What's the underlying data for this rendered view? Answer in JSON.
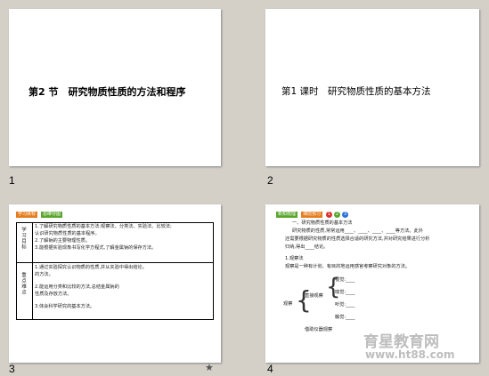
{
  "slides": [
    {
      "number": "1",
      "title": "第2 节　研究物质性质的方法和程序"
    },
    {
      "number": "2",
      "title": "第1 课时　研究物质性质的基本方法"
    },
    {
      "number": "3",
      "tags": [
        "学习目标",
        "思维导图"
      ],
      "section_labels": [
        "学习目标",
        "重点难点"
      ],
      "goals": [
        "1.了解研究物质性质的基本方法:观察法、分类法、实验法、比较法;",
        "认识研究物质性质的基本程序。",
        "2.了解钠的主要物理性质。",
        "3.能根据实验现象书写化学方程式,了解金属钠的保存方法。"
      ],
      "keypoints": [
        "1.通过实验探究认识物质的性质,并从实验中得出结论。",
        "的方法。",
        "2.能运用分类和比较的方法,总结金属钠的",
        "性质及存放方法。",
        "3.体会科学研究的基本方法。"
      ],
      "star": "★"
    },
    {
      "number": "4",
      "tags": [
        "新知梳理",
        "课前预习"
      ],
      "dots": [
        "1",
        "2",
        "3"
      ],
      "lines": [
        "一、研究物质性质的基本方法",
        "研究物质的性质,常常运用____、____、____、____等方法。此外",
        "还需要根据研究物质的性质选择合适的研究方法,并对研究结果进行分析",
        "归纳,得出____结论。",
        "1.观察法",
        "观察是一种有计划、有目的地运用感官考察研究对象的方法。"
      ],
      "diagram_labels": {
        "root": "观察",
        "direct": "直接观察",
        "indirect": "借助仪器观察",
        "items": [
          "视觉:____",
          "嗅觉:____",
          "听觉:____",
          "触觉:____"
        ]
      },
      "watermark_cn": "育星教育网",
      "watermark_url": "www.ht88.com"
    }
  ]
}
